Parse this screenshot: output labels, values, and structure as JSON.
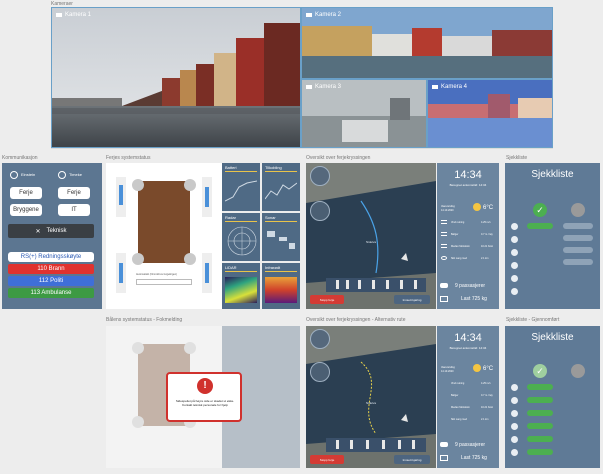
{
  "sections": {
    "cameras": "Kameraer",
    "comm": "Kommunikasjon",
    "ferry_status": "Ferjes systemstatus",
    "overview": "Oversikt over ferjekryssingen",
    "checklist": "Sjekkliste",
    "bridge_status": "Bålens systemstatus - Fokmelding",
    "overview_alt": "Oversikt over ferjekryssingen - Alternativ rute",
    "checklist_review": "Sjekkliste - Gjennomført"
  },
  "cameras": [
    "Kamera 1",
    "Kamera 2",
    "Kamera 3",
    "Kamera 4"
  ],
  "comm": {
    "einstein": "Einstein",
    "timer": "Timeke",
    "ferje1": "Ferje",
    "ferje2": "Ferje",
    "bryggene": "Bryggene",
    "it": "IT",
    "teknisk": "Teknisk",
    "rescue": "RS(+) Redningsskøyte",
    "fire": "110 Brann",
    "police": "112 Politi",
    "ambulance": "113 Ambulanse"
  },
  "ferry": {
    "caption": "Automatiskt (Omrodtt av fergekirgen)",
    "tiles": [
      "Batteri",
      "Tilkobling",
      "Radar",
      "Sonar",
      "LiDAR",
      "Infrarødt"
    ]
  },
  "info": {
    "time": "14:34",
    "arrival": "Beregnet ankomsttid: 14:34",
    "weather_label": "Vaervarsling",
    "date": "14.10.2020",
    "temp": "6°C",
    "rows": [
      "Vind retning",
      "Bølger",
      "Medan Motstrøm",
      "Sikt Lang med"
    ],
    "vals": [
      "4.25 m/s",
      "0.7 m. høy",
      "10.21 Kost",
      "2.1 km"
    ],
    "passengers": "9 passasjerer",
    "load": "Last 725 kg"
  },
  "map": {
    "ferry_name": "Nidelva",
    "stop": "Stopp ferje",
    "dock": "Innsett kjøring"
  },
  "checklist": {
    "title": "Sjekkliste"
  },
  "alert": {
    "text": "Sidespeilet på høyre side er skadet ut ekke. Kontakt teknisk personale for hjelp"
  },
  "colors": {
    "panel": "#5c7691",
    "fire": "#e0322f",
    "police": "#3f6fd8",
    "ambulance": "#3d9a43",
    "accent": "#e8c34a"
  }
}
